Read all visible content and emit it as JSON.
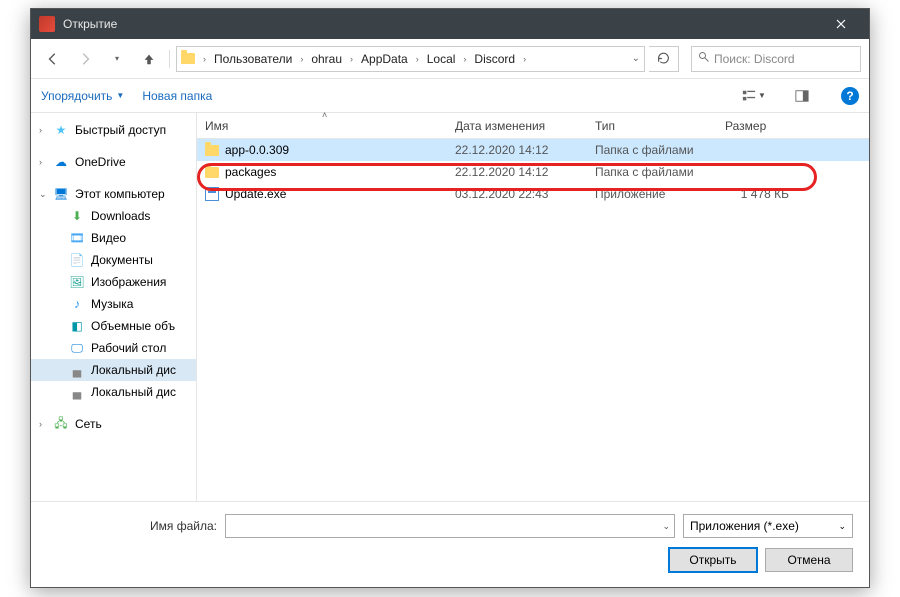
{
  "window": {
    "title": "Открытие"
  },
  "nav": {
    "segments": [
      "Пользователи",
      "ohrau",
      "AppData",
      "Local",
      "Discord"
    ],
    "search_placeholder": "Поиск: Discord"
  },
  "toolbar": {
    "organize": "Упорядочить",
    "new_folder": "Новая папка"
  },
  "sidebar": {
    "quick": "Быстрый доступ",
    "onedrive": "OneDrive",
    "thispc": "Этот компьютер",
    "downloads": "Downloads",
    "videos": "Видео",
    "documents": "Документы",
    "pictures": "Изображения",
    "music": "Музыка",
    "objects3d": "Объемные объ",
    "desktop": "Рабочий стол",
    "drive_c": "Локальный дис",
    "drive_d": "Локальный дис",
    "network": "Сеть"
  },
  "columns": {
    "name": "Имя",
    "date": "Дата изменения",
    "type": "Тип",
    "size": "Размер"
  },
  "files": [
    {
      "name": "app-0.0.309",
      "date": "22.12.2020 14:12",
      "type": "Папка с файлами",
      "size": "",
      "icon": "folder",
      "selected": true
    },
    {
      "name": "packages",
      "date": "22.12.2020 14:12",
      "type": "Папка с файлами",
      "size": "",
      "icon": "folder",
      "selected": false
    },
    {
      "name": "Update.exe",
      "date": "03.12.2020 22:43",
      "type": "Приложение",
      "size": "1 478 КБ",
      "icon": "exe",
      "selected": false
    }
  ],
  "footer": {
    "filename_label": "Имя файла:",
    "filename_value": "",
    "filter": "Приложения (*.exe)",
    "open": "Открыть",
    "cancel": "Отмена"
  }
}
